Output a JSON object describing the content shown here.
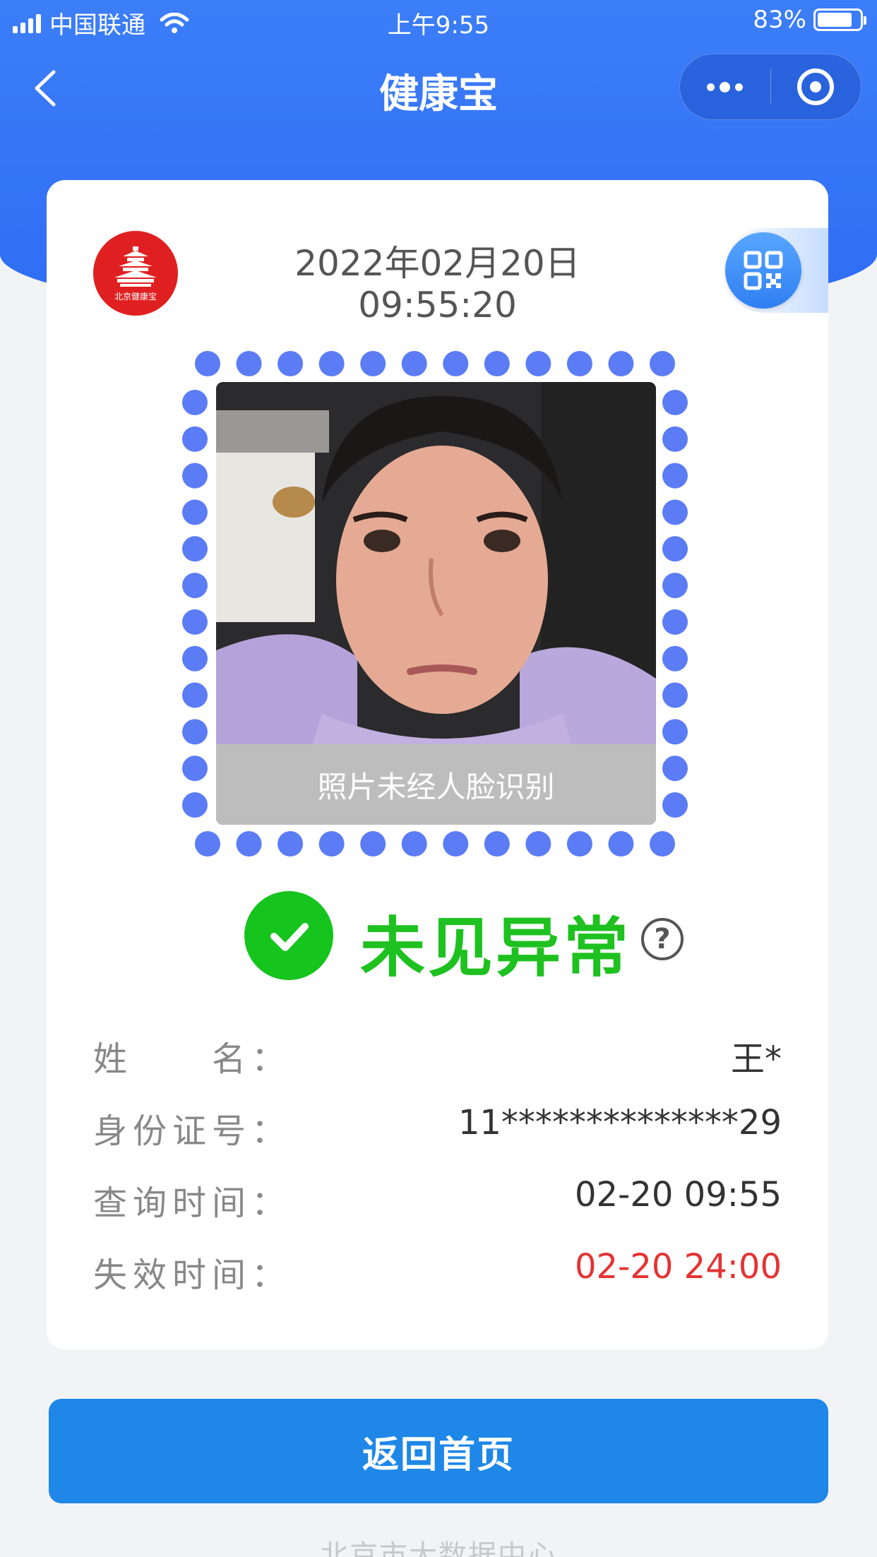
{
  "status_bar": {
    "carrier": "中国联通",
    "time": "上午9:55",
    "battery_percent": "83%",
    "battery_level": 0.83
  },
  "nav": {
    "title": "健康宝"
  },
  "card": {
    "logo_text": "北京健康宝",
    "date": "2022年02月20日",
    "time": "09:55:20",
    "photo_caption": "照片未经人脸识别",
    "status_text": "未见异常",
    "status_color": "#1ec11f",
    "info": {
      "name_label": "姓　　名：",
      "name_value": "王*",
      "id_label": "身份证号：",
      "id_value": "11**************29",
      "query_label": "查询时间：",
      "query_value": "02-20 09:55",
      "expire_label": "失效时间：",
      "expire_value": "02-20 24:00"
    }
  },
  "home_button": "返回首页",
  "footer": "北京市大数据中心",
  "icons": {
    "back": "back-chevron-icon",
    "more": "more-dots-icon",
    "close": "target-icon",
    "qr": "qr-code-icon",
    "check": "check-icon",
    "help": "help-icon"
  }
}
